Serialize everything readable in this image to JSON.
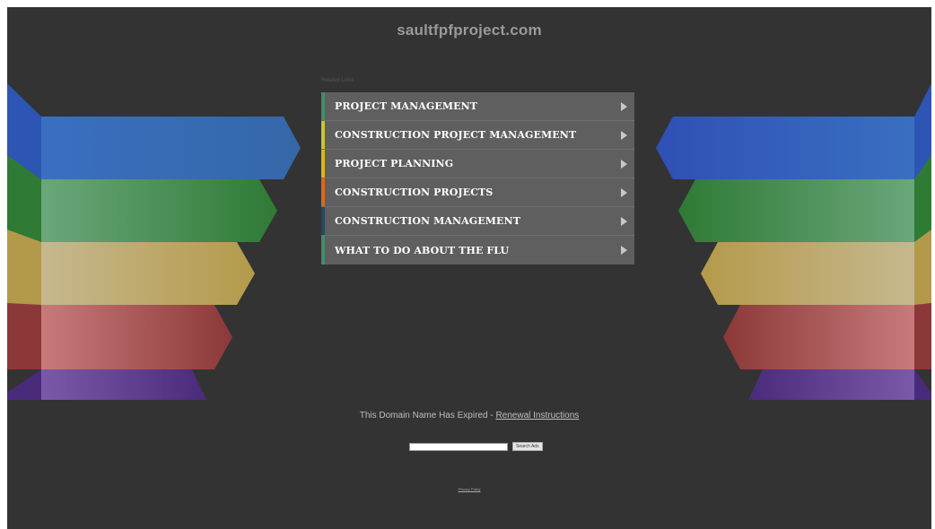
{
  "page": {
    "title": "saultfpfproject.com",
    "related_label": "Related Links"
  },
  "links": [
    {
      "label": "PROJECT MANAGEMENT",
      "accent": "#3e8e6e"
    },
    {
      "label": "CONSTRUCTION PROJECT MANAGEMENT",
      "accent": "#c8c43a"
    },
    {
      "label": "PROJECT PLANNING",
      "accent": "#e0b31c"
    },
    {
      "label": "CONSTRUCTION PROJECTS",
      "accent": "#d56a1f"
    },
    {
      "label": "CONSTRUCTION MANAGEMENT",
      "accent": "#244a60"
    },
    {
      "label": "WHAT TO DO ABOUT THE FLU",
      "accent": "#3e8e6e"
    }
  ],
  "footer": {
    "expired_text": "This Domain Name Has Expired - ",
    "renewal_link": "Renewal Instructions",
    "search_button": "Search Ads",
    "privacy_link": "Privacy Policy"
  },
  "colors": {
    "background": "#333333",
    "panel": "#5f5f5f",
    "arrow_blue": "#3b6fb8",
    "arrow_green": "#4d8f52",
    "arrow_yellow": "#b9a86a",
    "arrow_red": "#a55a5a",
    "arrow_purple": "#5a3a8a"
  }
}
